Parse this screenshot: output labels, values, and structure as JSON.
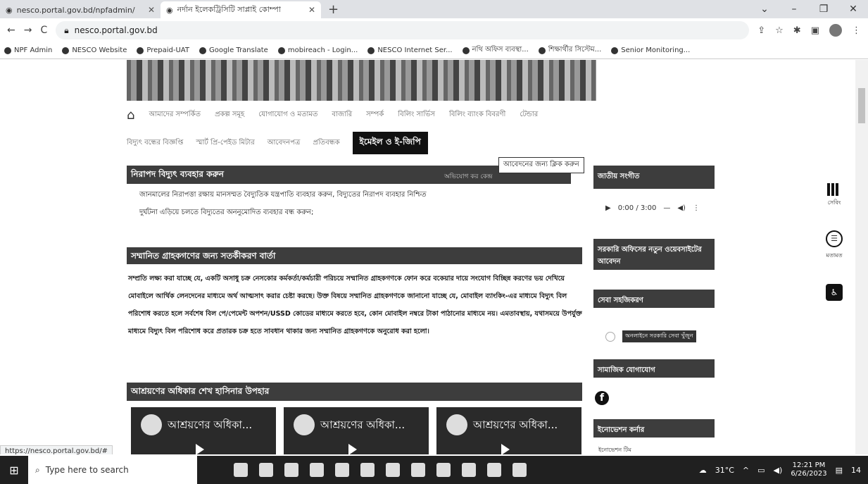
{
  "browser": {
    "tabs": [
      {
        "title": "nesco.portal.gov.bd/npfadmin/",
        "active": false
      },
      {
        "title": "নর্দান ইলেকট্রিসিটি সাপ্লাই কোম্পা",
        "active": true
      }
    ],
    "new_tab": "+",
    "url": "nesco.portal.gov.bd",
    "bookmarks": [
      "NPF Admin",
      "NESCO Website",
      "Prepaid-UAT",
      "Google Translate",
      "mobireach - Login...",
      "NESCO Internet Ser...",
      "নথি অফিস ব্যবস্থা...",
      "শিক্ষার্থীর সিস্টেম...",
      "Senior Monitoring..."
    ],
    "status_url": "https://nesco.portal.gov.bd/#"
  },
  "page": {
    "main_nav": [
      "আমাদের সম্পর্কিত",
      "প্রকল্প সমূহ",
      "যোগাযোগ ও মতামত",
      "বাজারি",
      "সম্পর্ক",
      "বিলিং সার্ভিস",
      "বিলিং ব্যাংক বিবরণী",
      "টেন্ডার"
    ],
    "sub_nav": [
      "বিদ্যুৎ বন্ধের বিজ্ঞপ্তি",
      "স্মার্ট প্রি-পেইড মিটার",
      "আবেদনপত্র",
      "প্রতিবন্ধক"
    ],
    "sub_nav_active": "ইমেইল ও ই-জিপি",
    "tooltip": "আবেদনের জন্য ক্লিক করুন",
    "safety_heading": "নিরাপদ বিদ্যুৎ ব্যবহার করুন",
    "safety_side": "অভিযোগ কর কেন্দ্র",
    "bullets": [
      "জানমালের নিরাপত্তা রক্ষায় মানসম্মত বৈদ্যুতিক যন্ত্রপাতি ব্যবহার করুন, বিদ্যুতের নিরাপদ ব্যবহার নিশ্চিত",
      "দুর্ঘটনা এড়িয়ে চলতে বিদ্যুতের অননুমোদিত ব্যবহার বন্ধ করুন;"
    ],
    "notice_heading": "সম্মানিত গ্রাহকগণের জন্য সতর্কীকরণ বার্তা",
    "notice_text": "সম্প্রতি লক্ষ্য করা যাচ্ছে যে, একটি অসাধু চক্র নেসকোর কর্মকর্তা/কর্মচারী পরিচয়ে সম্মানিত গ্রাহকগণকে ফোন করে বকেয়ার দায়ে সংযোগ বিচ্ছিন্ন করণের ভয় দেখিয়ে মোবাইলে আর্থিক লেনদেনের মাধ্যমে অর্থ আত্মসাৎ করার চেষ্টা করছে। উক্ত বিষয়ে সম্মানিত গ্রাহকগণকে জানানো যাচ্ছে যে, মোবাইল ব্যাংকিং-এর মাধ্যমে বিদ্যুৎ বিল পরিশোধ করতে হলে সর্বশেষ বিল পে/পেমেন্ট অপশন/USSD কোডের মাধ্যমে করতে হবে, কোন মোবাইল নম্বরে টাকা পাঠানোর মাধ্যমে নয়। এমতাবস্থায়, যথাসময়ে উপর্যুক্ত মাধ্যমে বিদ্যুৎ বিল পরিশোধ করে প্রতারক চক্র হতে সাবধান থাকার জন্য সম্মানিত গ্রাহকগণকে অনুরোধ করা হলো।",
    "shelter_heading": "আশ্রয়ণের অধিকার শেখ হাসিনার উপহার",
    "videos": [
      "আশ্রয়ণের অধিকা...",
      "আশ্রয়ণের অধিকা...",
      "আশ্রয়ণের অধিকা..."
    ]
  },
  "sidebar": {
    "anthem_heading": "জাতীয় সংগীত",
    "audio_time": "0:00 / 3:00",
    "box1": "সরকারি অফিসের নতুন ওয়েবসাইটের আবেদন",
    "box2": "সেবা সহজিকরণ",
    "link1": "অনলাইনে সরকারি সেবা খুঁজুন",
    "box3": "সামাজিক যোগাযোগ",
    "fb": "f",
    "box4": "ইনোভেশন কর্নার",
    "link2": "ইনোভেশন টিম"
  },
  "side_widgets": {
    "label1": "সেবিং",
    "label2": "মতামত"
  },
  "taskbar": {
    "search_placeholder": "Type here to search",
    "weather": "31°C",
    "time": "12:21 PM",
    "date": "6/26/2023",
    "notif_count": "14"
  }
}
